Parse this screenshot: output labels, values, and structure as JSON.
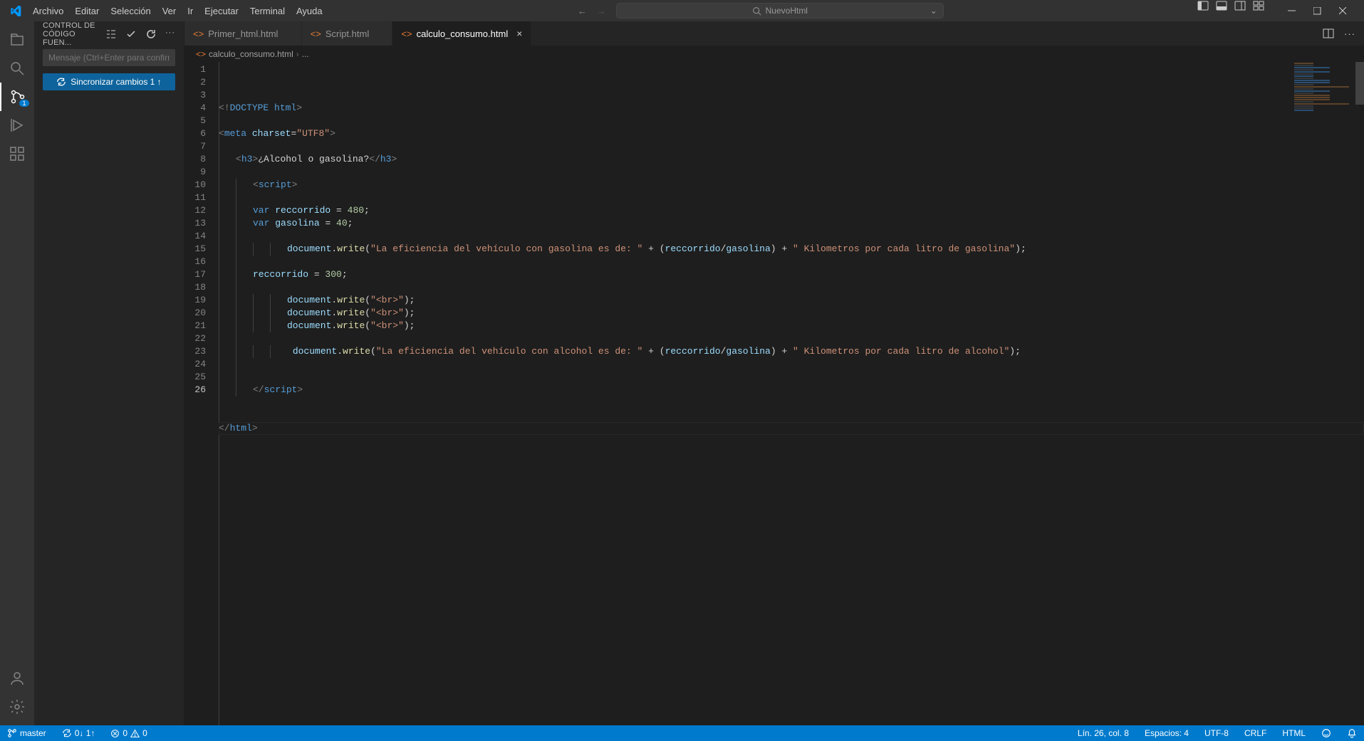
{
  "menu": {
    "items": [
      "Archivo",
      "Editar",
      "Selección",
      "Ver",
      "Ir",
      "Ejecutar",
      "Terminal",
      "Ayuda"
    ]
  },
  "command_center": {
    "text": "NuevoHtml"
  },
  "sidebar": {
    "title": "CONTROL DE CÓDIGO FUEN...",
    "message_placeholder": "Mensaje (Ctrl+Enter para confirmar en \"...",
    "sync_label": "Sincronizar cambios 1 ↑"
  },
  "activitybar": {
    "badge": "1"
  },
  "tabs": [
    {
      "label": "Primer_html.html",
      "active": false
    },
    {
      "label": "Script.html",
      "active": false
    },
    {
      "label": "calculo_consumo.html",
      "active": true
    }
  ],
  "breadcrumbs": {
    "file": "calculo_consumo.html",
    "rest": "..."
  },
  "code": {
    "lines": [
      {
        "n": 1,
        "indent": 0,
        "tokens": [
          [
            "tk-gray",
            "<!"
          ],
          [
            "tk-doctype",
            "DOCTYPE"
          ],
          [
            "tk-white",
            " "
          ],
          [
            "tk-tag",
            "html"
          ],
          [
            "tk-gray",
            ">"
          ]
        ]
      },
      {
        "n": 2,
        "indent": 0,
        "tokens": []
      },
      {
        "n": 3,
        "indent": 0,
        "tokens": [
          [
            "tk-gray",
            "<"
          ],
          [
            "tk-tag",
            "meta"
          ],
          [
            "tk-white",
            " "
          ],
          [
            "tk-attr",
            "charset"
          ],
          [
            "tk-white",
            "="
          ],
          [
            "tk-str",
            "\"UTF8\""
          ],
          [
            "tk-gray",
            ">"
          ]
        ]
      },
      {
        "n": 4,
        "indent": 0,
        "tokens": []
      },
      {
        "n": 5,
        "indent": 1,
        "tokens": [
          [
            "tk-gray",
            "<"
          ],
          [
            "tk-tag",
            "h3"
          ],
          [
            "tk-gray",
            ">"
          ],
          [
            "tk-white",
            "¿Alcohol o gasolina?"
          ],
          [
            "tk-gray",
            "</"
          ],
          [
            "tk-tag",
            "h3"
          ],
          [
            "tk-gray",
            ">"
          ]
        ]
      },
      {
        "n": 6,
        "indent": 1,
        "tokens": []
      },
      {
        "n": 7,
        "indent": 2,
        "tokens": [
          [
            "tk-gray",
            "<"
          ],
          [
            "tk-tag",
            "script"
          ],
          [
            "tk-gray",
            ">"
          ]
        ]
      },
      {
        "n": 8,
        "indent": 2,
        "tokens": []
      },
      {
        "n": 9,
        "indent": 2,
        "tokens": [
          [
            "tk-kw",
            "var"
          ],
          [
            "tk-white",
            " "
          ],
          [
            "tk-var",
            "reccorrido"
          ],
          [
            "tk-white",
            " = "
          ],
          [
            "tk-num",
            "480"
          ],
          [
            "tk-white",
            ";"
          ]
        ]
      },
      {
        "n": 10,
        "indent": 2,
        "tokens": [
          [
            "tk-kw",
            "var"
          ],
          [
            "tk-white",
            " "
          ],
          [
            "tk-var",
            "gasolina"
          ],
          [
            "tk-white",
            " = "
          ],
          [
            "tk-num",
            "40"
          ],
          [
            "tk-white",
            ";"
          ]
        ]
      },
      {
        "n": 11,
        "indent": 2,
        "tokens": []
      },
      {
        "n": 12,
        "indent": 4,
        "tokens": [
          [
            "tk-obj",
            "document"
          ],
          [
            "tk-white",
            "."
          ],
          [
            "tk-fn",
            "write"
          ],
          [
            "tk-white",
            "("
          ],
          [
            "tk-str",
            "\"La eficiencia del vehículo con gasolina es de: \""
          ],
          [
            "tk-white",
            " + ("
          ],
          [
            "tk-var",
            "reccorrido"
          ],
          [
            "tk-white",
            "/"
          ],
          [
            "tk-var",
            "gasolina"
          ],
          [
            "tk-white",
            ") + "
          ],
          [
            "tk-str",
            "\" Kilometros por cada litro de gasolina\""
          ],
          [
            "tk-white",
            ");"
          ]
        ]
      },
      {
        "n": 13,
        "indent": 2,
        "tokens": []
      },
      {
        "n": 14,
        "indent": 2,
        "tokens": [
          [
            "tk-var",
            "reccorrido"
          ],
          [
            "tk-white",
            " = "
          ],
          [
            "tk-num",
            "300"
          ],
          [
            "tk-white",
            ";"
          ]
        ]
      },
      {
        "n": 15,
        "indent": 2,
        "tokens": []
      },
      {
        "n": 16,
        "indent": 4,
        "tokens": [
          [
            "tk-obj",
            "document"
          ],
          [
            "tk-white",
            "."
          ],
          [
            "tk-fn",
            "write"
          ],
          [
            "tk-white",
            "("
          ],
          [
            "tk-str",
            "\"<br>\""
          ],
          [
            "tk-white",
            ");"
          ]
        ]
      },
      {
        "n": 17,
        "indent": 4,
        "tokens": [
          [
            "tk-obj",
            "document"
          ],
          [
            "tk-white",
            "."
          ],
          [
            "tk-fn",
            "write"
          ],
          [
            "tk-white",
            "("
          ],
          [
            "tk-str",
            "\"<br>\""
          ],
          [
            "tk-white",
            ");"
          ]
        ]
      },
      {
        "n": 18,
        "indent": 4,
        "tokens": [
          [
            "tk-obj",
            "document"
          ],
          [
            "tk-white",
            "."
          ],
          [
            "tk-fn",
            "write"
          ],
          [
            "tk-white",
            "("
          ],
          [
            "tk-str",
            "\"<br>\""
          ],
          [
            "tk-white",
            ");"
          ]
        ]
      },
      {
        "n": 19,
        "indent": 2,
        "tokens": []
      },
      {
        "n": 20,
        "indent": 4,
        "tokens": [
          [
            "tk-white",
            " "
          ],
          [
            "tk-obj",
            "document"
          ],
          [
            "tk-white",
            "."
          ],
          [
            "tk-fn",
            "write"
          ],
          [
            "tk-white",
            "("
          ],
          [
            "tk-str",
            "\"La eficiencia del vehículo con alcohol es de: \""
          ],
          [
            "tk-white",
            " + ("
          ],
          [
            "tk-var",
            "reccorrido"
          ],
          [
            "tk-white",
            "/"
          ],
          [
            "tk-var",
            "gasolina"
          ],
          [
            "tk-white",
            ") + "
          ],
          [
            "tk-str",
            "\" Kilometros por cada litro de alcohol\""
          ],
          [
            "tk-white",
            ");"
          ]
        ]
      },
      {
        "n": 21,
        "indent": 2,
        "tokens": []
      },
      {
        "n": 22,
        "indent": 2,
        "tokens": []
      },
      {
        "n": 23,
        "indent": 2,
        "tokens": [
          [
            "tk-gray",
            "</"
          ],
          [
            "tk-tag",
            "script"
          ],
          [
            "tk-gray",
            ">"
          ]
        ]
      },
      {
        "n": 24,
        "indent": 0,
        "tokens": []
      },
      {
        "n": 25,
        "indent": 0,
        "tokens": []
      },
      {
        "n": 26,
        "indent": 0,
        "active": true,
        "tokens": [
          [
            "tk-gray",
            "</"
          ],
          [
            "tk-tag",
            "html"
          ],
          [
            "tk-gray",
            ">"
          ]
        ]
      }
    ]
  },
  "status": {
    "branch": "master",
    "sync": "0↓ 1↑",
    "errors": "0",
    "warnings": "0",
    "position": "Lín. 26, col. 8",
    "spaces": "Espacios: 4",
    "encoding": "UTF-8",
    "eol": "CRLF",
    "language": "HTML"
  }
}
